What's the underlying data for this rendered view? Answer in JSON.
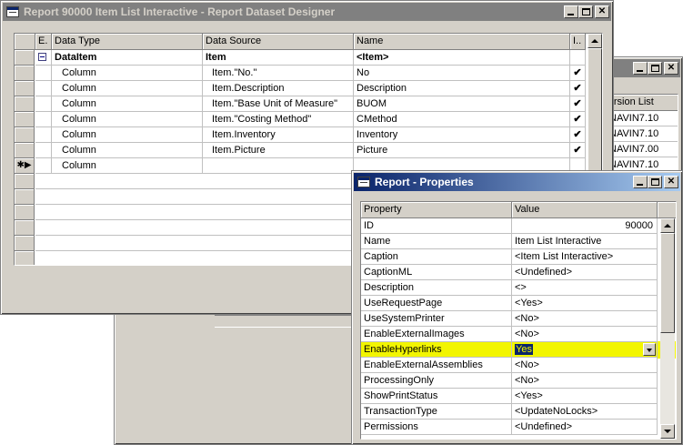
{
  "back_window": {
    "column_header": "Version List",
    "versions": [
      "NAVIN7.10",
      "NAVIN7.10",
      "NAVIN7.00",
      "NAVIN7.10"
    ]
  },
  "designer": {
    "title": "Report 90000 Item List Interactive - Report Dataset Designer",
    "columns": {
      "e": "E.",
      "data_type": "Data Type",
      "data_source": "Data Source",
      "name": "Name",
      "include": "I.."
    },
    "rows": [
      {
        "data_type": "DataItem",
        "data_source": "Item",
        "name": "<Item>",
        "include": ""
      },
      {
        "data_type": "Column",
        "data_source": "Item.\"No.\"",
        "name": "No",
        "include": "✔"
      },
      {
        "data_type": "Column",
        "data_source": "Item.Description",
        "name": "Description",
        "include": "✔"
      },
      {
        "data_type": "Column",
        "data_source": "Item.\"Base Unit of Measure\"",
        "name": "BUOM",
        "include": "✔"
      },
      {
        "data_type": "Column",
        "data_source": "Item.\"Costing Method\"",
        "name": "CMethod",
        "include": "✔"
      },
      {
        "data_type": "Column",
        "data_source": "Item.Inventory",
        "name": "Inventory",
        "include": "✔"
      },
      {
        "data_type": "Column",
        "data_source": "Item.Picture",
        "name": "Picture",
        "include": "✔"
      },
      {
        "data_type": "Column",
        "data_source": "",
        "name": "",
        "include": ""
      }
    ],
    "new_row_marker": "✱▶"
  },
  "properties": {
    "title": "Report - Properties",
    "columns": {
      "property": "Property",
      "value": "Value"
    },
    "rows": [
      {
        "property": "ID",
        "value": "90000"
      },
      {
        "property": "Name",
        "value": "Item List Interactive"
      },
      {
        "property": "Caption",
        "value": "<Item List Interactive>"
      },
      {
        "property": "CaptionML",
        "value": "<Undefined>"
      },
      {
        "property": "Description",
        "value": "<>"
      },
      {
        "property": "UseRequestPage",
        "value": "<Yes>"
      },
      {
        "property": "UseSystemPrinter",
        "value": "<No>"
      },
      {
        "property": "EnableExternalImages",
        "value": "<No>"
      },
      {
        "property": "EnableHyperlinks",
        "value": "Yes"
      },
      {
        "property": "EnableExternalAssemblies",
        "value": "<No>"
      },
      {
        "property": "ProcessingOnly",
        "value": "<No>"
      },
      {
        "property": "ShowPrintStatus",
        "value": "<Yes>"
      },
      {
        "property": "TransactionType",
        "value": "<UpdateNoLocks>"
      },
      {
        "property": "Permissions",
        "value": "<Undefined>"
      }
    ],
    "highlight_color": "#f2f500"
  }
}
